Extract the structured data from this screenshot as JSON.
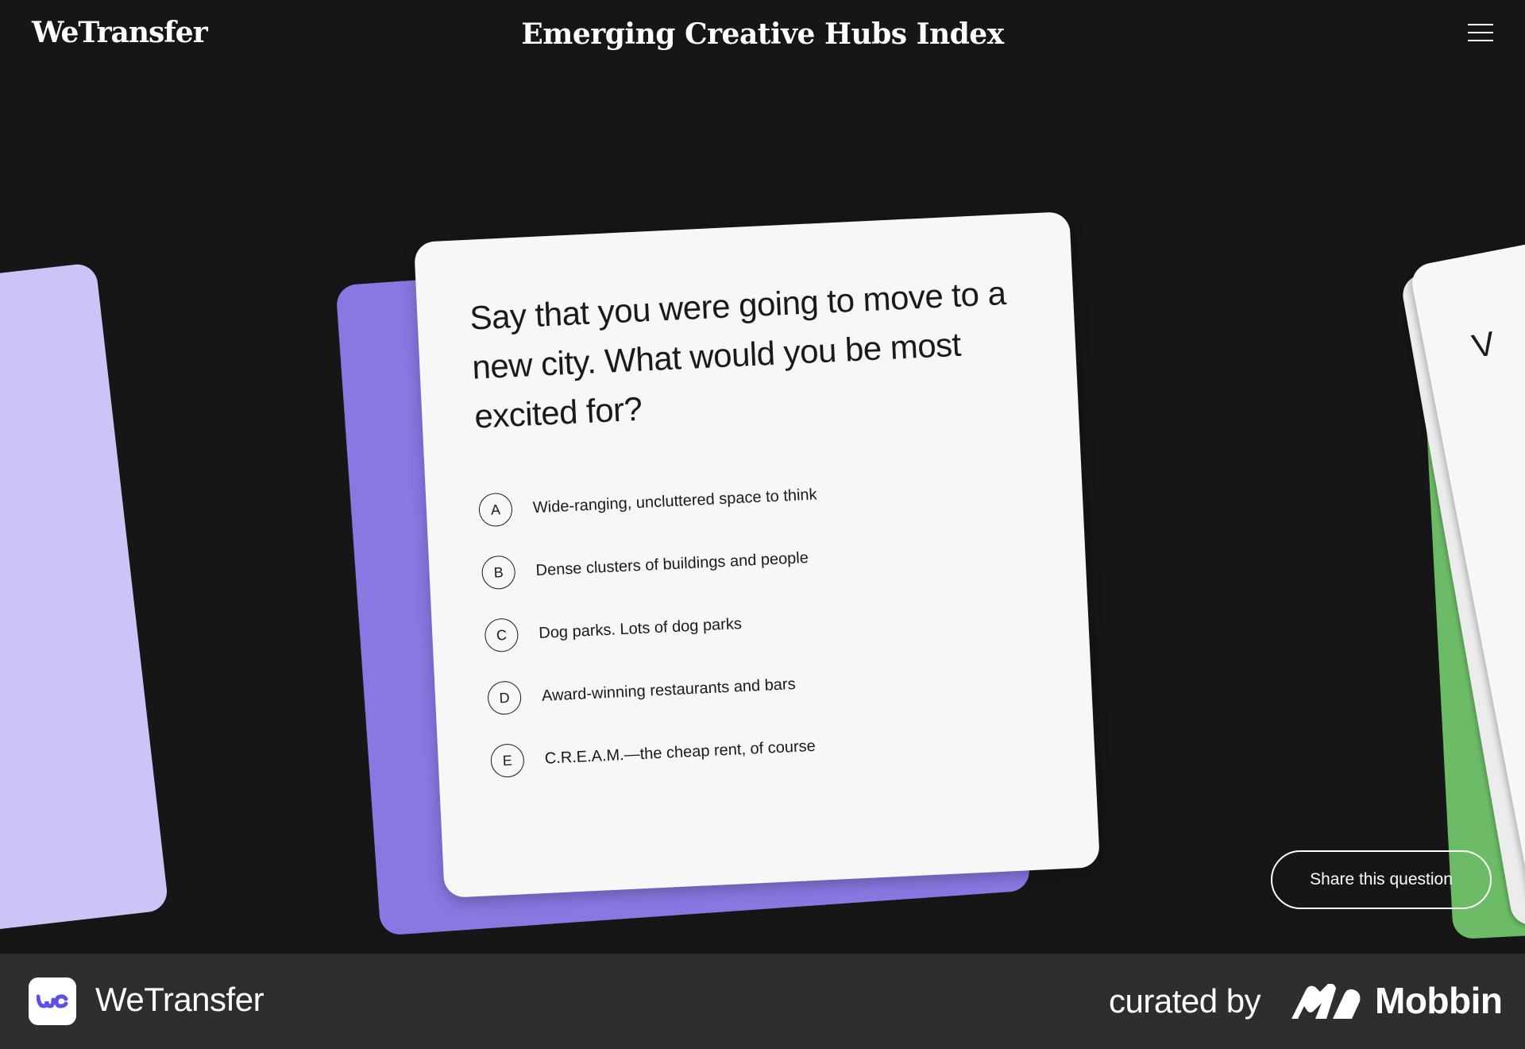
{
  "header": {
    "brand": "WeTransfer",
    "title": "Emerging Creative Hubs Index",
    "menu_icon": "hamburger-menu-icon"
  },
  "question_card": {
    "question": "Say that you were going to move to a new city. What would you be most excited for?",
    "options": [
      {
        "letter": "A",
        "text": "Wide-ranging, uncluttered space to think"
      },
      {
        "letter": "B",
        "text": "Dense clusters of buildings and people"
      },
      {
        "letter": "C",
        "text": "Dog parks. Lots of dog parks"
      },
      {
        "letter": "D",
        "text": "Award-winning restaurants and bars"
      },
      {
        "letter": "E",
        "text": "C.R.E.A.M.—the cheap rent, of course"
      }
    ]
  },
  "next_card": {
    "peek_text": "V"
  },
  "share_button": {
    "label": "Share this question"
  },
  "footer": {
    "app_icon": "wetransfer-app-icon",
    "app_name": "WeTransfer",
    "curated_by": "curated by",
    "mobbin_logo_icon": "mobbin-logo-icon",
    "mobbin_name": "Mobbin"
  },
  "colors": {
    "background": "#161616",
    "footer_background": "#2e2e2e",
    "card_left": "#cbc4f6",
    "card_back": "#8878e2",
    "card_front": "#f7f7f7",
    "card_right_green": "#6cbb67",
    "app_icon_accent": "#5b50e8"
  }
}
